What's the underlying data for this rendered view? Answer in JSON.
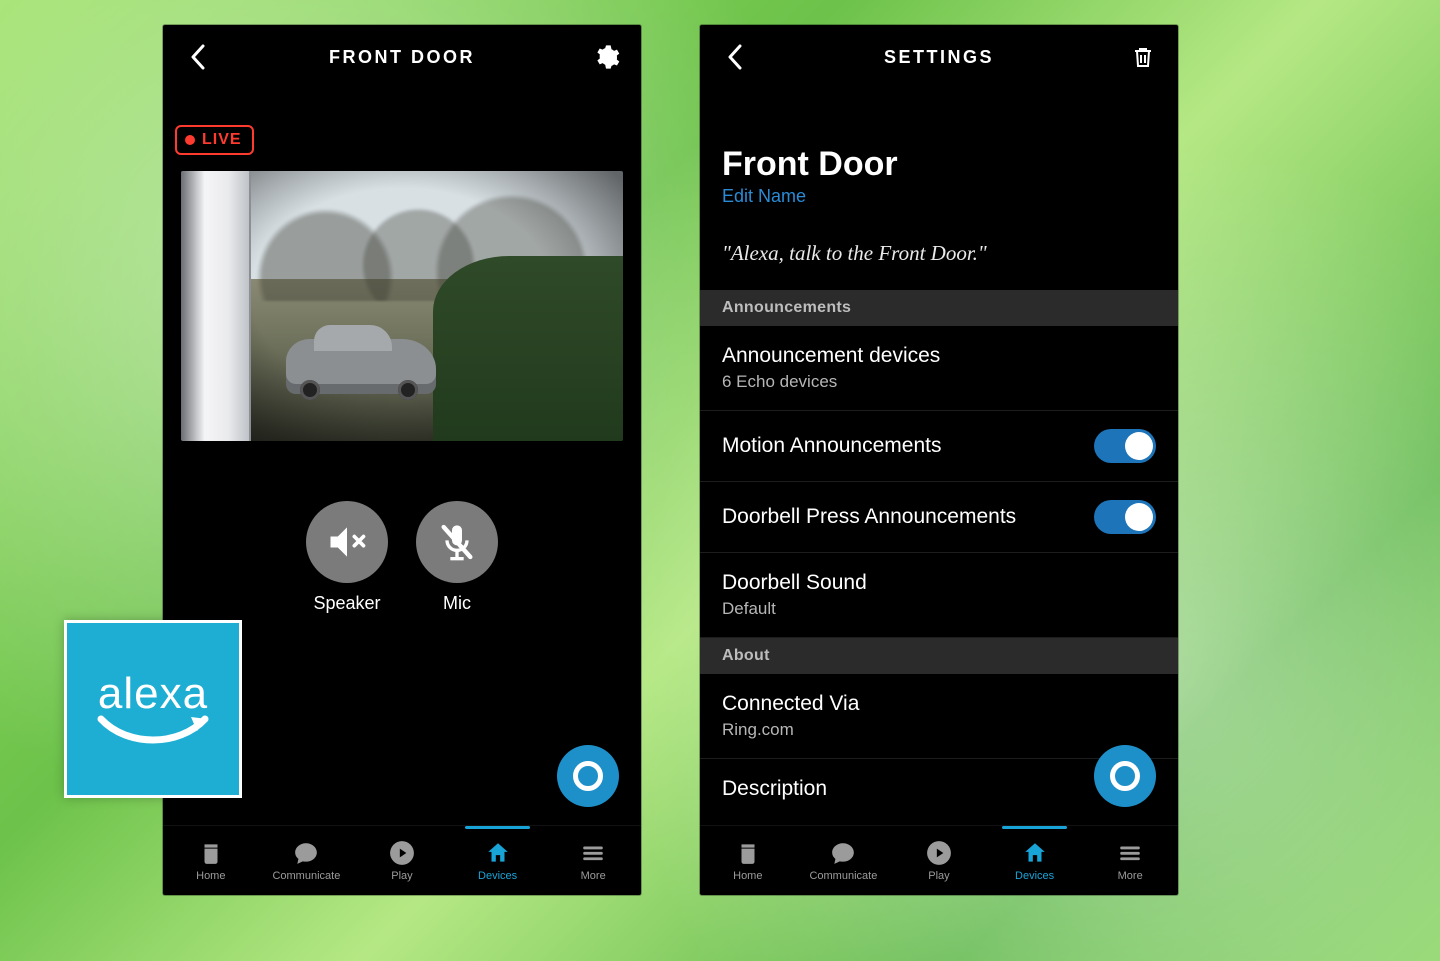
{
  "left": {
    "headerTitle": "FRONT DOOR",
    "liveBadge": "LIVE",
    "controls": {
      "speaker": "Speaker",
      "mic": "Mic"
    }
  },
  "right": {
    "headerTitle": "SETTINGS",
    "deviceName": "Front Door",
    "editName": "Edit Name",
    "voiceHint": "\"Alexa, talk to the Front Door.\"",
    "sections": {
      "announcements": "Announcements",
      "about": "About"
    },
    "rows": {
      "announcementDevices": {
        "primary": "Announcement devices",
        "secondary": "6 Echo devices"
      },
      "motion": {
        "primary": "Motion Announcements"
      },
      "doorbellPress": {
        "primary": "Doorbell Press Announcements"
      },
      "doorbellSound": {
        "primary": "Doorbell Sound",
        "secondary": "Default"
      },
      "connectedVia": {
        "primary": "Connected Via",
        "secondary": "Ring.com"
      },
      "description": {
        "primary": "Description"
      }
    }
  },
  "nav": {
    "home": "Home",
    "communicate": "Communicate",
    "play": "Play",
    "devices": "Devices",
    "more": "More"
  },
  "logo": "alexa"
}
